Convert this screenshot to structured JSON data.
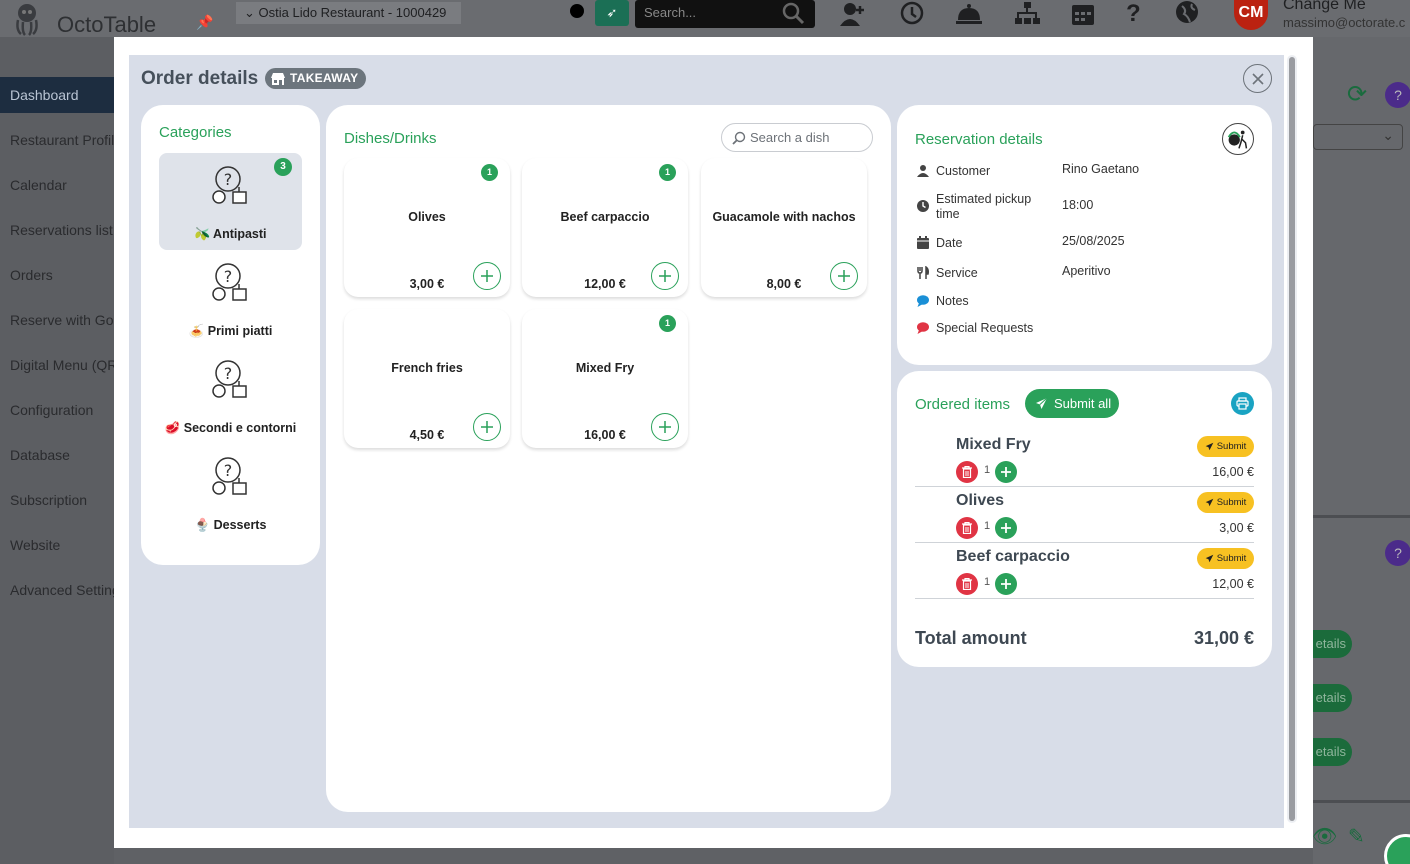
{
  "app": {
    "logo_text": "OctoTable",
    "restaurant": "Ostia Lido Restaurant - 1000429",
    "search_placeholder": "Search...",
    "user_initials": "CM",
    "user_name": "Change Me",
    "user_email": "massimo@octorate.c"
  },
  "sidebar": {
    "items": [
      {
        "label": "Dashboard"
      },
      {
        "label": "Restaurant Profile"
      },
      {
        "label": "Calendar"
      },
      {
        "label": "Reservations list"
      },
      {
        "label": "Orders"
      },
      {
        "label": "Reserve with Google"
      },
      {
        "label": "Digital Menu (QR)"
      },
      {
        "label": "Configuration"
      },
      {
        "label": "Database"
      },
      {
        "label": "Subscription"
      },
      {
        "label": "Website"
      },
      {
        "label": "Advanced Settings"
      }
    ]
  },
  "background": {
    "details_label": "etails"
  },
  "modal": {
    "title": "Order details",
    "badge": "TAKEAWAY",
    "categories": {
      "title": "Categories",
      "items": [
        {
          "emoji": "🫒",
          "label": "Antipasti",
          "count": "3"
        },
        {
          "emoji": "🍝",
          "label": "Primi piatti"
        },
        {
          "emoji": "🥩",
          "label": "Secondi e contorni"
        },
        {
          "emoji": "🍨",
          "label": "Desserts"
        }
      ]
    },
    "dishes": {
      "title": "Dishes/Drinks",
      "search_placeholder": "Search a dish",
      "items": [
        {
          "name": "Olives",
          "price": "3,00 €",
          "count": "1"
        },
        {
          "name": "Beef carpaccio",
          "price": "12,00 €",
          "count": "1"
        },
        {
          "name": "Guacamole with nachos",
          "price": "8,00 €"
        },
        {
          "name": "French fries",
          "price": "4,50 €"
        },
        {
          "name": "Mixed Fry",
          "price": "16,00 €",
          "count": "1"
        }
      ]
    },
    "reservation": {
      "title": "Reservation details",
      "rows": [
        {
          "icon": "user-icon",
          "label": "Customer",
          "value": "Rino Gaetano"
        },
        {
          "icon": "clock-icon",
          "label": "Estimated pickup time",
          "value": "18:00"
        },
        {
          "icon": "calendar-icon",
          "label": "Date",
          "value": "25/08/2025"
        },
        {
          "icon": "utensils-icon",
          "label": "Service",
          "value": "Aperitivo"
        },
        {
          "icon": "comment-icon",
          "label": "Notes",
          "value": ""
        },
        {
          "icon": "comment-icon",
          "label": "Special Requests",
          "value": ""
        }
      ]
    },
    "ordered": {
      "title": "Ordered items",
      "submit_all_label": "Submit all",
      "items": [
        {
          "name": "Mixed Fry",
          "qty": "1",
          "price": "16,00 €",
          "submit_label": "Submit"
        },
        {
          "name": "Olives",
          "qty": "1",
          "price": "3,00 €",
          "submit_label": "Submit"
        },
        {
          "name": "Beef carpaccio",
          "qty": "1",
          "price": "12,00 €",
          "submit_label": "Submit"
        }
      ],
      "total_label": "Total amount",
      "total_value": "31,00 €"
    }
  },
  "colors": {
    "accent_green": "#2aa15a",
    "danger_red": "#e03444",
    "warning_yellow": "#f7c122",
    "info_blue": "#1aa3c2"
  }
}
